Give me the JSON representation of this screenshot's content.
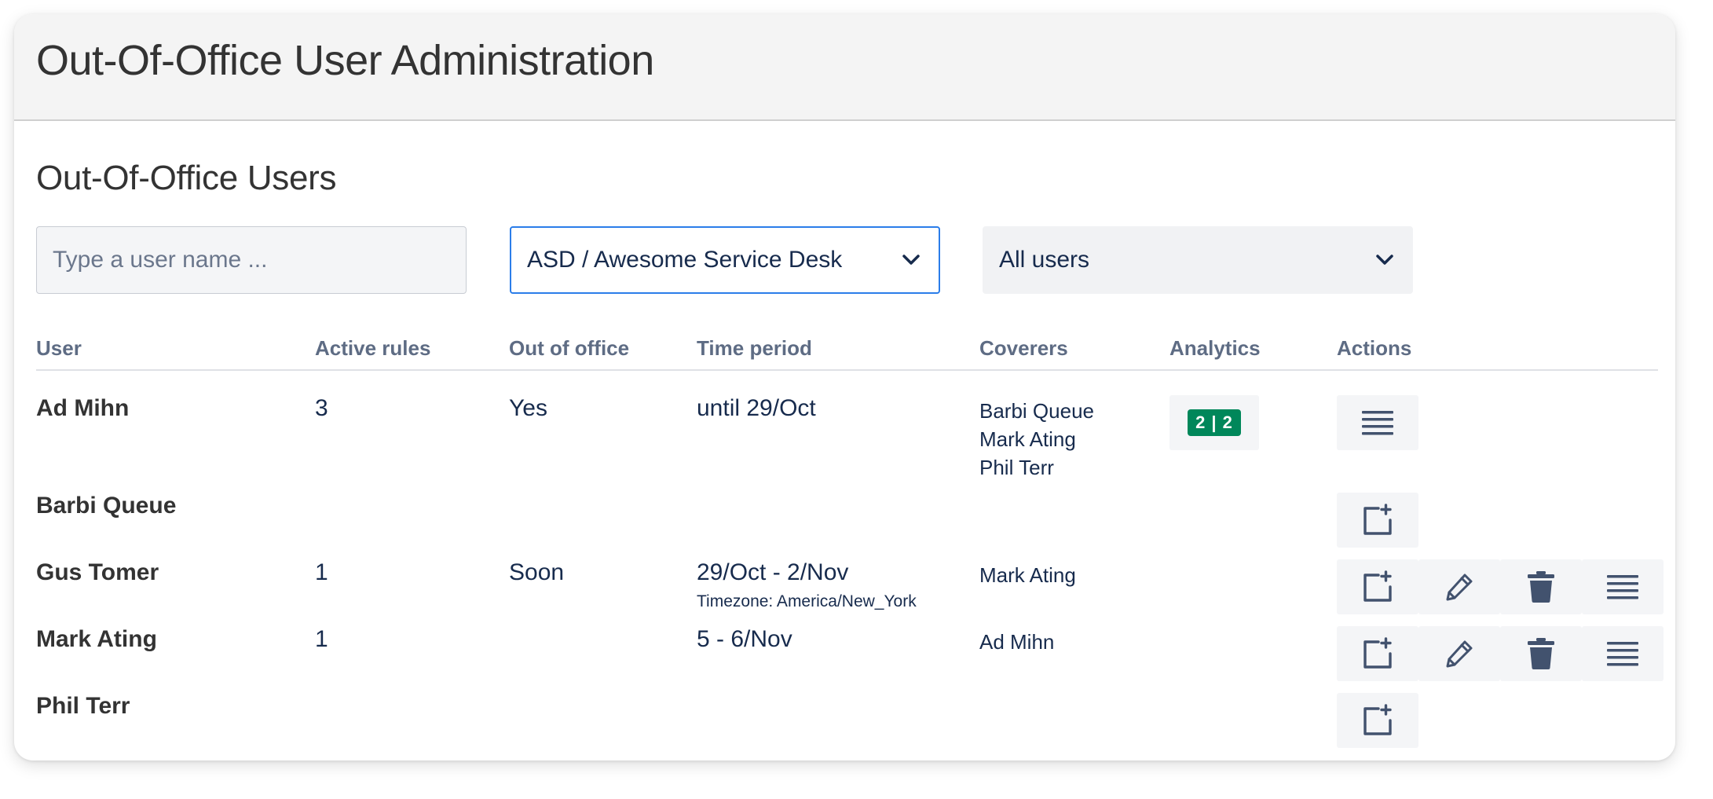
{
  "header": {
    "title": "Out-Of-Office User Administration"
  },
  "section": {
    "title": "Out-Of-Office Users"
  },
  "search": {
    "placeholder": "Type a user name ...",
    "value": ""
  },
  "project_select": {
    "value": "ASD / Awesome Service Desk"
  },
  "user_filter": {
    "value": "All users"
  },
  "table": {
    "columns": [
      "User",
      "Active rules",
      "Out of office",
      "Time period",
      "Coverers",
      "Analytics",
      "Actions"
    ],
    "rows": [
      {
        "user": "Ad Mihn",
        "active_rules": "3",
        "out_of_office": "Yes",
        "time_period": "until 29/Oct",
        "timezone": "",
        "coverers": [
          "Barbi Queue",
          "Mark Ating",
          "Phil Terr"
        ],
        "analytics": "2 | 2",
        "actions": [
          "list-icon"
        ]
      },
      {
        "user": "Barbi Queue",
        "active_rules": "",
        "out_of_office": "",
        "time_period": "",
        "timezone": "",
        "coverers": [],
        "analytics": "",
        "actions": [
          "add-rule-icon"
        ]
      },
      {
        "user": "Gus Tomer",
        "active_rules": "1",
        "out_of_office": "Soon",
        "time_period": "29/Oct - 2/Nov",
        "timezone": "Timezone: America/New_York",
        "coverers": [
          "Mark Ating"
        ],
        "analytics": "",
        "actions": [
          "add-rule-icon",
          "pencil-icon",
          "trash-icon",
          "list-icon"
        ]
      },
      {
        "user": "Mark Ating",
        "active_rules": "1",
        "out_of_office": "",
        "time_period": "5 - 6/Nov",
        "timezone": "",
        "coverers": [
          "Ad Mihn"
        ],
        "analytics": "",
        "actions": [
          "add-rule-icon",
          "pencil-icon",
          "trash-icon",
          "list-icon"
        ]
      },
      {
        "user": "Phil Terr",
        "active_rules": "",
        "out_of_office": "",
        "time_period": "",
        "timezone": "",
        "coverers": [],
        "analytics": "",
        "actions": [
          "add-rule-icon"
        ]
      }
    ]
  },
  "colors": {
    "accent": "#2b7de9",
    "badge": "#00875a",
    "icon": "#42526e",
    "header_bg": "#f4f4f4"
  }
}
